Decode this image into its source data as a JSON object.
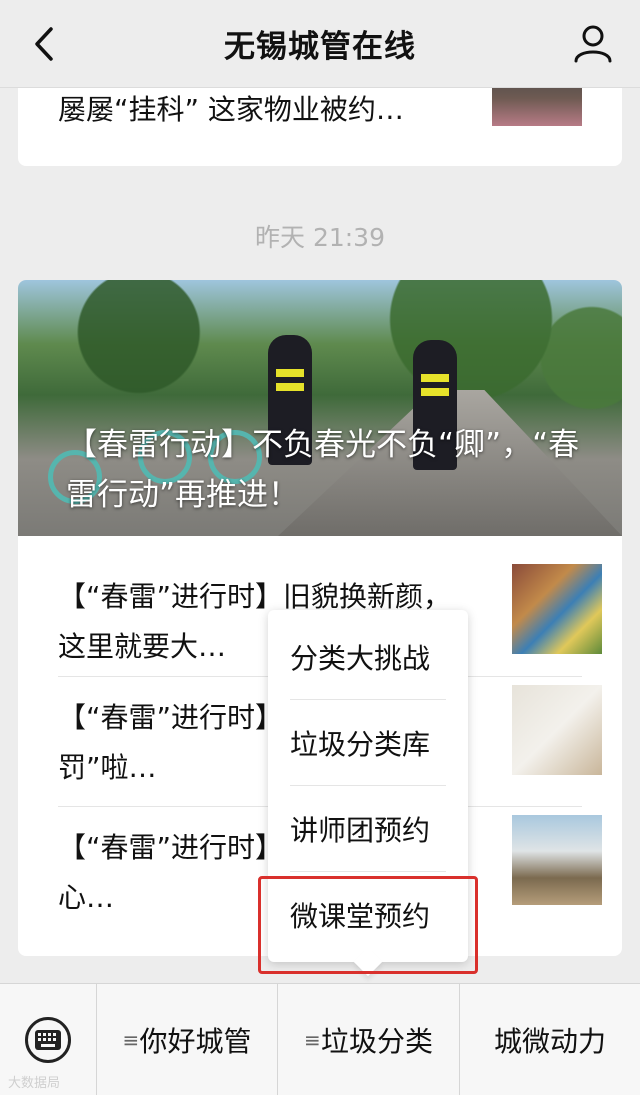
{
  "header": {
    "title": "无锡城管在线",
    "back_icon": "chevron-left-icon",
    "profile_icon": "person-icon"
  },
  "top_card": {
    "text": "屡屡“挂科” 这家物业被约…"
  },
  "timestamp": "昨天 21:39",
  "main_card": {
    "hero_caption": "【春雷行动】不负春光不负“卿”，“春雷行动”再推进！",
    "items": [
      {
        "text": "【“春雷”进行时】旧貌换新颜，这里就要大…"
      },
      {
        "text": "【“春雷”进行时】锡小管“开罚”啦…"
      },
      {
        "text": "【“春雷”进行时】了，我们就放心…"
      }
    ]
  },
  "popup_menu": {
    "items": [
      "分类大挑战",
      "垃圾分类库",
      "讲师团预约",
      "微课堂预约"
    ],
    "highlighted": "微课堂预约",
    "highlight_color": "#d9302c"
  },
  "bottom_bar": {
    "keyboard_icon": "keyboard-icon",
    "tabs": [
      {
        "label": "你好城管",
        "has_menu": true
      },
      {
        "label": "垃圾分类",
        "has_menu": true
      },
      {
        "label": "城微动力",
        "has_menu": false
      }
    ]
  },
  "watermark": "大数据局"
}
